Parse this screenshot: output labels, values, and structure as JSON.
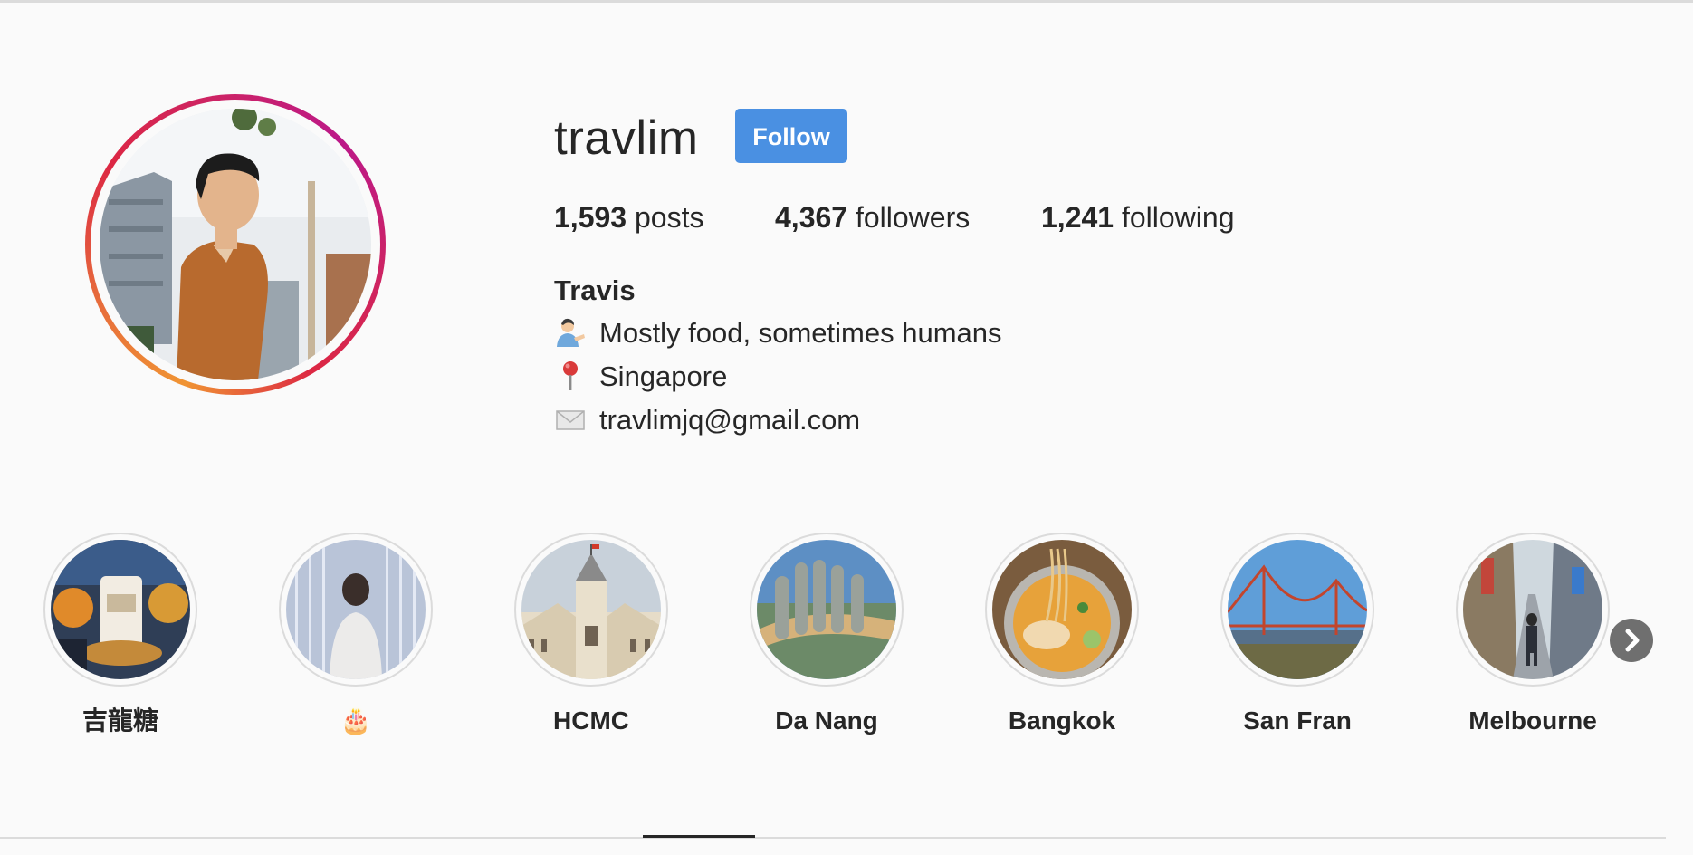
{
  "profile": {
    "username": "travlim",
    "follow_label": "Follow",
    "stats": {
      "posts_count": "1,593",
      "posts_label": "posts",
      "followers_count": "4,367",
      "followers_label": "followers",
      "following_count": "1,241",
      "following_label": "following"
    },
    "bio": {
      "name": "Travis",
      "lines": [
        {
          "icon": "person-tipping-hand-icon",
          "text": "Mostly food, sometimes humans"
        },
        {
          "icon": "round-pushpin-icon",
          "text": "Singapore"
        },
        {
          "icon": "envelope-icon",
          "text": "travlimjq@gmail.com"
        }
      ]
    }
  },
  "highlights": [
    {
      "label": "吉龍糖"
    },
    {
      "label": "🎂"
    },
    {
      "label": "HCMC"
    },
    {
      "label": "Da Nang"
    },
    {
      "label": "Bangkok"
    },
    {
      "label": "San Fran"
    },
    {
      "label": "Melbourne"
    }
  ],
  "controls": {
    "next_icon": "chevron-right-icon"
  },
  "colors": {
    "follow_button": "#4a90e2",
    "background": "#fafafa",
    "text": "#262626",
    "divider": "#dbdbdb"
  }
}
